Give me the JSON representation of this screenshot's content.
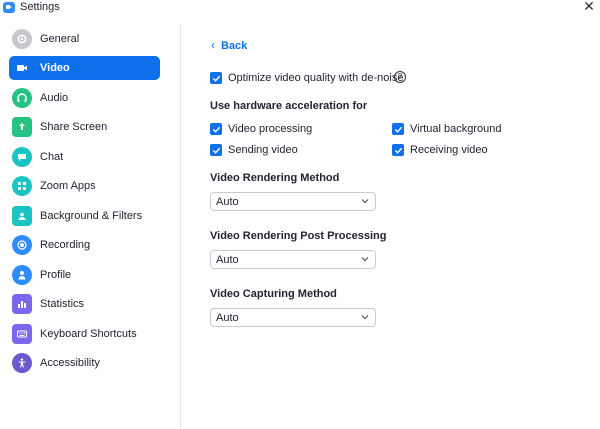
{
  "window": {
    "title": "Settings",
    "close_glyph": "✕"
  },
  "sidebar": {
    "items": [
      {
        "label": "General",
        "icon": "gear-icon",
        "color": "#c7c7cc",
        "active": false
      },
      {
        "label": "Video",
        "icon": "video-camera-icon",
        "color": "#0E71EB",
        "active": true
      },
      {
        "label": "Audio",
        "icon": "headphones-icon",
        "color": "#26C281",
        "active": false
      },
      {
        "label": "Share Screen",
        "icon": "share-screen-icon",
        "color": "#26C281",
        "active": false
      },
      {
        "label": "Chat",
        "icon": "chat-icon",
        "color": "#1BC3C3",
        "active": false
      },
      {
        "label": "Zoom Apps",
        "icon": "apps-icon",
        "color": "#1BC3C3",
        "active": false
      },
      {
        "label": "Background & Filters",
        "icon": "background-icon",
        "color": "#1BC3C3",
        "active": false
      },
      {
        "label": "Recording",
        "icon": "record-icon",
        "color": "#2D8CFF",
        "active": false
      },
      {
        "label": "Profile",
        "icon": "profile-icon",
        "color": "#2D8CFF",
        "active": false
      },
      {
        "label": "Statistics",
        "icon": "statistics-icon",
        "color": "#7B68EE",
        "active": false
      },
      {
        "label": "Keyboard Shortcuts",
        "icon": "keyboard-icon",
        "color": "#7B68EE",
        "active": false
      },
      {
        "label": "Accessibility",
        "icon": "accessibility-icon",
        "color": "#6A5ACD",
        "active": false
      }
    ]
  },
  "content": {
    "back_label": "Back",
    "back_glyph": "‹",
    "denoise": {
      "label": "Optimize video quality with de-noise",
      "checked": true,
      "help_glyph": "?"
    },
    "hw_accel": {
      "title": "Use hardware acceleration for",
      "options": [
        {
          "label": "Video processing",
          "checked": true
        },
        {
          "label": "Virtual background",
          "checked": true
        },
        {
          "label": "Sending video",
          "checked": true
        },
        {
          "label": "Receiving video",
          "checked": true
        }
      ]
    },
    "rendering_method": {
      "title": "Video Rendering Method",
      "value": "Auto"
    },
    "post_processing": {
      "title": "Video Rendering Post Processing",
      "value": "Auto"
    },
    "capturing_method": {
      "title": "Video Capturing Method",
      "value": "Auto"
    }
  },
  "colors": {
    "accent": "#0E71EB",
    "text": "#232333",
    "divider": "#e8e8ec"
  }
}
